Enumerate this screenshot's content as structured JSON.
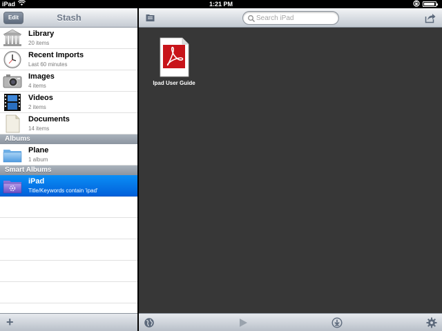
{
  "status_bar": {
    "carrier": "iPad",
    "time": "1:21 PM",
    "battery_level": 0.95
  },
  "left_pane": {
    "title": "Stash",
    "edit_label": "Edit",
    "library_items": [
      {
        "title": "Library",
        "subtitle": "20 items",
        "icon": "library-icon"
      },
      {
        "title": "Recent Imports",
        "subtitle": "Last 60 minutes",
        "icon": "clock-icon"
      },
      {
        "title": "Images",
        "subtitle": "4 items",
        "icon": "camera-icon"
      },
      {
        "title": "Videos",
        "subtitle": "2 items",
        "icon": "film-icon"
      },
      {
        "title": "Documents",
        "subtitle": "14 items",
        "icon": "document-icon"
      }
    ],
    "albums_header": "Albums",
    "albums": [
      {
        "title": "Plane",
        "subtitle": "1 album",
        "icon": "folder-icon"
      }
    ],
    "smart_albums_header": "Smart Albums",
    "smart_albums": [
      {
        "title": "iPad",
        "subtitle": "Title/Keywords contain 'ipad'",
        "icon": "smart-folder-icon",
        "selected": true
      }
    ],
    "add_label": "+"
  },
  "right_pane": {
    "search_placeholder": "Search iPad",
    "files": [
      {
        "name": "Ipad User Guide",
        "icon": "pdf-icon"
      }
    ],
    "colors": {
      "content_bg": "#373737",
      "selection": "#0a73e8",
      "pdf_red": "#c8141a"
    }
  }
}
